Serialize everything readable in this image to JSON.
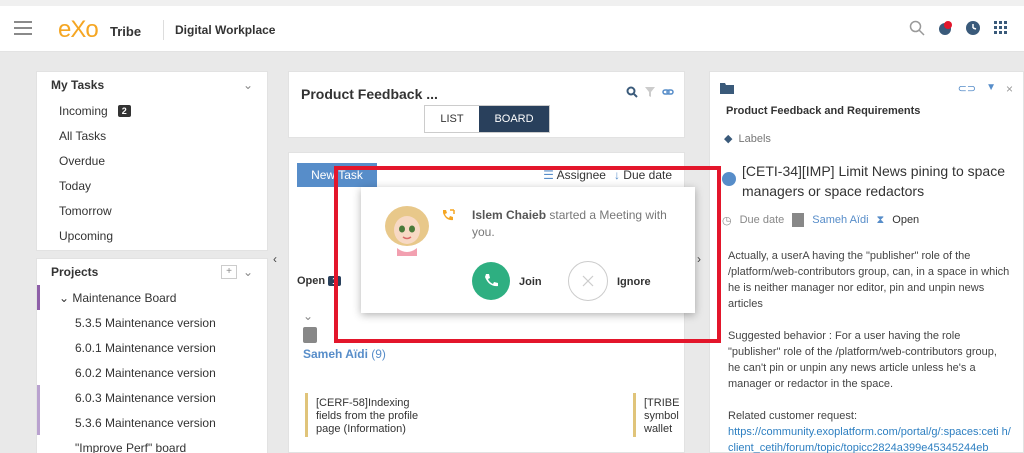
{
  "topbar": {
    "logo": "eXo",
    "brand": "Tribe",
    "workspace": "Digital Workplace"
  },
  "my_tasks": {
    "title": "My Tasks",
    "items": [
      {
        "label": "Incoming",
        "badge": "2"
      },
      {
        "label": "All Tasks"
      },
      {
        "label": "Overdue"
      },
      {
        "label": "Today"
      },
      {
        "label": "Tomorrow"
      },
      {
        "label": "Upcoming"
      }
    ]
  },
  "projects": {
    "title": "Projects",
    "items": [
      "Maintenance Board",
      "5.3.5 Maintenance version",
      "6.0.1 Maintenance version",
      "6.0.2 Maintenance version",
      "6.0.3 Maintenance version",
      "5.3.6 Maintenance version",
      "\"Improve Perf\" board"
    ]
  },
  "center": {
    "title": "Product Feedback ...",
    "view_list": "LIST",
    "view_board": "BOARD",
    "new_task": "New Task",
    "sort_assignee": "Assignee",
    "sort_due": "Due date",
    "open_label": "Open",
    "open_count": "1",
    "assignee": "Sameh Aïdi",
    "assignee_count": "(9)",
    "card1": "[CERF-58]Indexing fields from the profile page (Information)",
    "card2": "[TRIBE symbol wallet v"
  },
  "right_panel": {
    "title": "Product Feedback and Requirements",
    "labels": "Labels",
    "task_title": "[CETI-34][IMP] Limit News pining to space managers or space redactors",
    "due_date": "Due date",
    "assignee": "Sameh Aïdi",
    "status": "Open",
    "body_p1": "Actually, a userA having the \"publisher\" role of the /platform/web-contributors group, can, in a space in which he is neither manager nor editor, pin and unpin news articles",
    "body_p2": "Suggested behavior : For a user having the role \"publisher\" role of the /platform/web-contributors group, he can't pin or unpin any news article unless he's a manager or redactor in the space.",
    "body_p3": "Related customer request:",
    "link": "https://community.exoplatform.com/portal/g/:spaces:ceti h/client_cetih/forum/topic/topicc2824a399e45345244eb"
  },
  "popup": {
    "caller": "Islem Chaieb",
    "message": " started a Meeting with you.",
    "join_label": "Join",
    "ignore_label": "Ignore"
  },
  "colors": {
    "accent": "#578dc9",
    "join": "#2eaf81",
    "highlight": "#e3162b",
    "nav_dark": "#29405c"
  }
}
